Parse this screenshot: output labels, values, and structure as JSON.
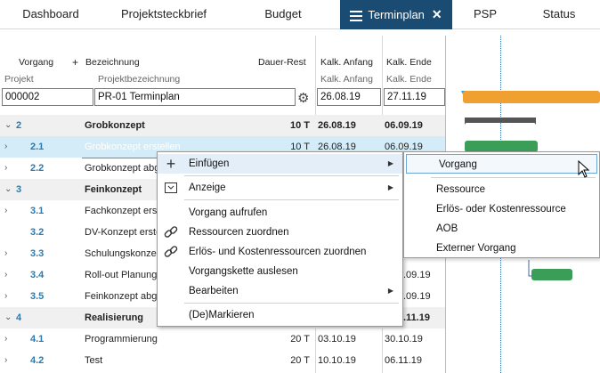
{
  "tabs": [
    {
      "label": "Dashboard"
    },
    {
      "label": "Projektsteckbrief"
    },
    {
      "label": "Budget"
    },
    {
      "label": "Terminplan"
    },
    {
      "label": "PSP"
    },
    {
      "label": "Status"
    }
  ],
  "headers": {
    "vorgang": "Vorgang",
    "plus": "+",
    "bezeichnung": "Bezeichnung",
    "dauer_rest": "Dauer-Rest",
    "kalk_anfang": "Kalk. Anfang",
    "kalk_ende": "Kalk. Ende",
    "projekt": "Projekt",
    "projektbezeichnung": "Projektbezeichnung"
  },
  "project": {
    "id": "000002",
    "name": "PR-01 Terminplan",
    "start": "26.08.19",
    "end": "27.11.19"
  },
  "rows": [
    {
      "chev": "⌄",
      "num": "2",
      "name": "Grobkonzept",
      "dur": "10 T",
      "start": "26.08.19",
      "end": "06.09.19"
    },
    {
      "chev": "›",
      "num": "2.1",
      "name": "Grobkonzept erstellen",
      "dur": "10 T",
      "start": "26.08.19",
      "end": "06.09.19"
    },
    {
      "chev": "›",
      "num": "2.2",
      "name": "Grobkonzept abg",
      "dur": "",
      "start": "",
      "end": ""
    },
    {
      "chev": "⌄",
      "num": "3",
      "name": "Feinkonzept",
      "dur": "",
      "start": "",
      "end": ""
    },
    {
      "chev": "›",
      "num": "3.1",
      "name": "Fachkonzept ers",
      "dur": "",
      "start": "",
      "end": ""
    },
    {
      "chev": "",
      "num": "3.2",
      "name": "DV-Konzept erste",
      "dur": "",
      "start": "",
      "end": ""
    },
    {
      "chev": "›",
      "num": "3.3",
      "name": "Schulungskonze",
      "dur": "",
      "start": "",
      "end": ""
    },
    {
      "chev": "›",
      "num": "3.4",
      "name": "Roll-out Planung",
      "dur": "",
      "start": "",
      "end": ".09.19"
    },
    {
      "chev": "›",
      "num": "3.5",
      "name": "Feinkonzept abg",
      "dur": "",
      "start": "",
      "end": ".09.19"
    },
    {
      "chev": "⌄",
      "num": "4",
      "name": "Realisierung",
      "dur": "",
      "start": "",
      "end": ".11.19"
    },
    {
      "chev": "›",
      "num": "4.1",
      "name": "Programmierung",
      "dur": "20 T",
      "start": "03.10.19",
      "end": "30.10.19"
    },
    {
      "chev": "›",
      "num": "4.2",
      "name": "Test",
      "dur": "20 T",
      "start": "10.10.19",
      "end": "06.11.19"
    }
  ],
  "context_menu": {
    "items": [
      {
        "label": "Einfügen",
        "icon": "plus-icon",
        "glyph": "+"
      },
      {
        "label": "Anzeige",
        "icon": "dropdown-box-icon",
        "glyph": "⌵"
      },
      {
        "label": "Vorgang aufrufen",
        "icon": "",
        "glyph": ""
      },
      {
        "label": "Ressourcen zuordnen",
        "icon": "link-icon",
        "glyph": "🔗"
      },
      {
        "label": "Erlös- und Kostenressourcen zuordnen",
        "icon": "link-icon",
        "glyph": "🔗"
      },
      {
        "label": "Vorgangskette auslesen",
        "icon": "",
        "glyph": ""
      },
      {
        "label": "Bearbeiten",
        "icon": "",
        "glyph": ""
      },
      {
        "label": "(De)Markieren",
        "icon": "",
        "glyph": ""
      }
    ]
  },
  "submenu": {
    "items": [
      {
        "label": "Vorgang"
      },
      {
        "label": "Ressource"
      },
      {
        "label": "Erlös- oder Kostenressource"
      },
      {
        "label": "AOB"
      },
      {
        "label": "Externer Vorgang"
      }
    ]
  },
  "colors": {
    "tab_active": "#1a4b73",
    "selection": "#2e9fd8",
    "bar_orange": "#f0a030",
    "bar_green": "#3a9e58",
    "bar_summary": "#555555"
  }
}
